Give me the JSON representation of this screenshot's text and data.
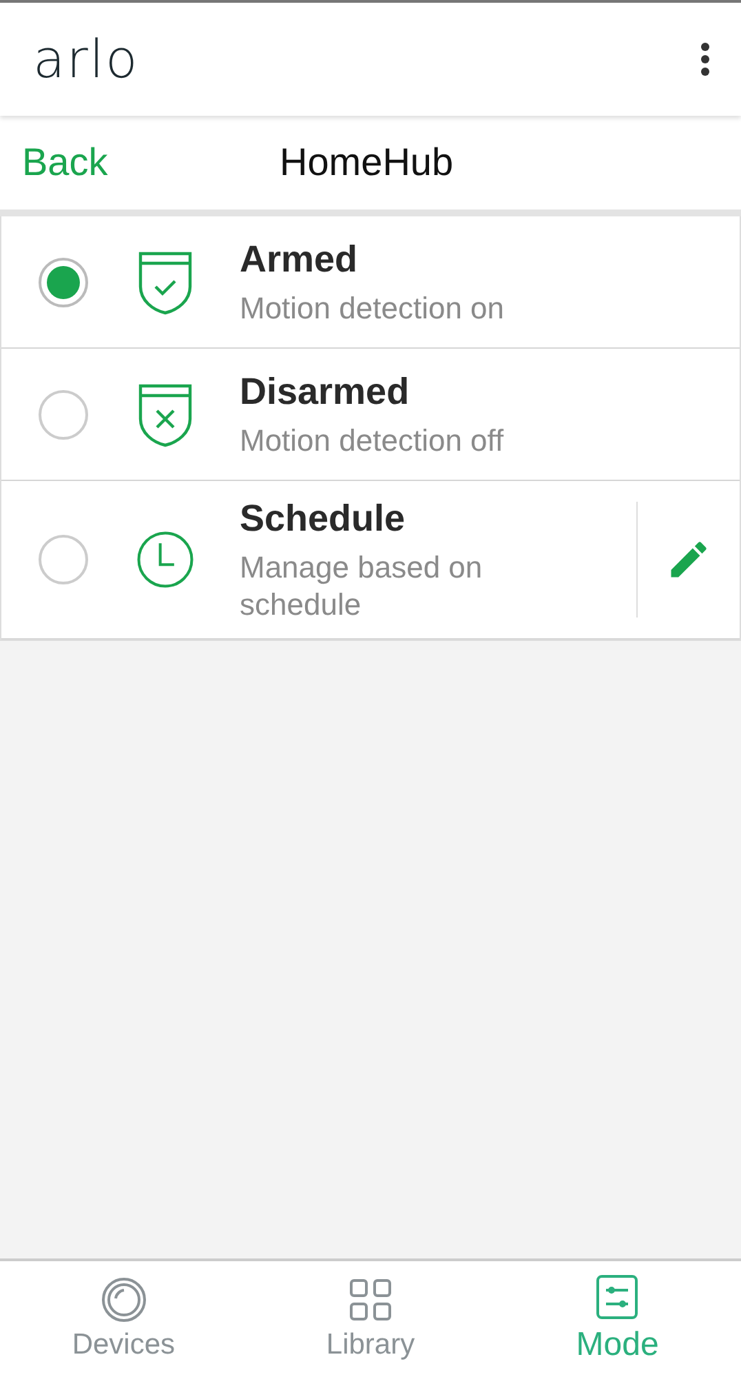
{
  "app_bar": {
    "logo": "arlo"
  },
  "nav": {
    "back": "Back",
    "title": "HomeHub"
  },
  "modes": [
    {
      "title": "Armed",
      "subtitle": "Motion detection on",
      "kind": "armed",
      "selected": true,
      "editable": false
    },
    {
      "title": "Disarmed",
      "subtitle": "Motion detection off",
      "kind": "disarmed",
      "selected": false,
      "editable": false
    },
    {
      "title": "Schedule",
      "subtitle": "Manage based on schedule",
      "kind": "schedule",
      "selected": false,
      "editable": true
    }
  ],
  "tabs": [
    {
      "label": "Devices",
      "kind": "devices",
      "selected": false
    },
    {
      "label": "Library",
      "kind": "library",
      "selected": false
    },
    {
      "label": "Mode",
      "kind": "mode",
      "selected": true
    }
  ]
}
